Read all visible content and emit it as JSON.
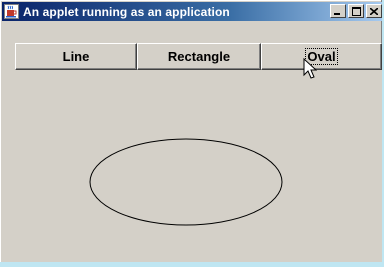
{
  "window": {
    "title": "An applet running as an application",
    "icon": "java-cup-icon",
    "controls": [
      "minimize-icon",
      "maximize-icon",
      "close-icon"
    ]
  },
  "toolbar": {
    "buttons": [
      {
        "label": "Line"
      },
      {
        "label": "Rectangle"
      },
      {
        "label": "Oval",
        "focused": true
      }
    ]
  },
  "canvas": {
    "shape": "oval",
    "stroke_color": "#000000"
  },
  "cursor": "arrow-pointer-icon",
  "colors": {
    "titlebar_start": "#0a246a",
    "titlebar_end": "#a6caf0",
    "face": "#d4d0c8",
    "background": "#bfe6f2"
  }
}
